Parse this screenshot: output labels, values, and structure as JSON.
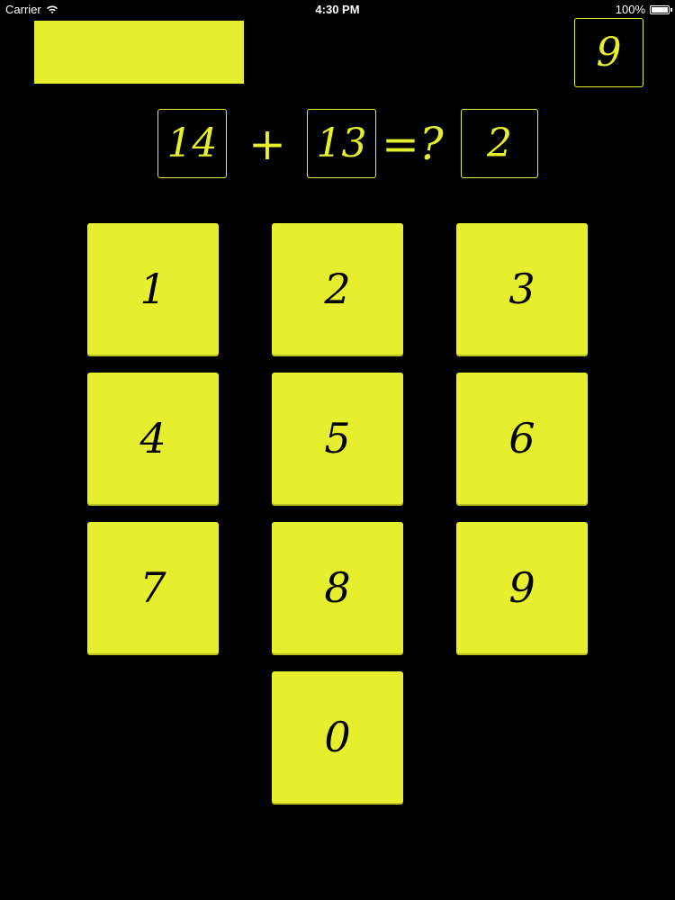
{
  "status_bar": {
    "carrier": "Carrier",
    "time": "4:30 PM",
    "battery_text": "100%",
    "battery_level": 1.0
  },
  "score": "9",
  "equation": {
    "operand1": "14",
    "operator": "+",
    "operand2": "13",
    "equals": "=?",
    "answer": "2"
  },
  "keypad": [
    "1",
    "2",
    "3",
    "4",
    "5",
    "6",
    "7",
    "8",
    "9",
    "0"
  ],
  "colors": {
    "accent": "#e6ef2e",
    "background": "#000000",
    "key_text": "#000000"
  }
}
